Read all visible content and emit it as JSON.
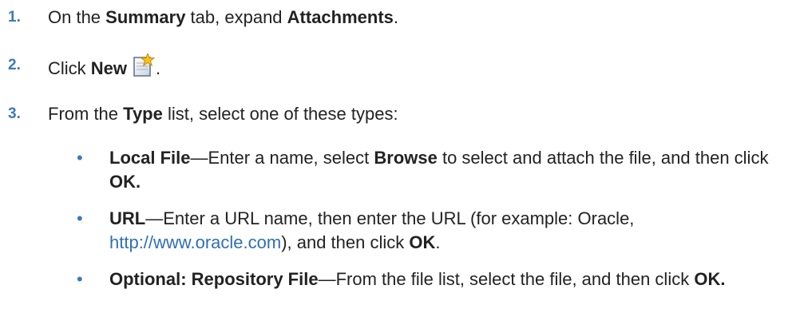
{
  "steps": [
    {
      "num": "1.",
      "pre": "On the ",
      "b1": "Summary",
      "mid": " tab, expand ",
      "b2": "Attachments",
      "post": "."
    },
    {
      "num": "2.",
      "pre": "Click ",
      "b1": "New",
      "icon": "new-document-icon",
      "post": "."
    },
    {
      "num": "3.",
      "pre": "From the ",
      "b1": "Type",
      "post": " list, select one of these types:"
    }
  ],
  "bullets": [
    {
      "mark": "•",
      "b1": "Local File",
      "t1": "—Enter a name, select ",
      "b2": "Browse",
      "t2": " to select and attach the file, and then click ",
      "b3": "OK."
    },
    {
      "mark": "•",
      "b1": "URL",
      "t1": "—Enter a URL name, then enter the URL (for example: Oracle, ",
      "link": "http://www.oracle.com",
      "t2": "), and then click ",
      "b2": "OK",
      "t3": "."
    },
    {
      "mark": "•",
      "b1": "Optional: Repository File",
      "t1": "—From the file list, select the file, and then click ",
      "b2": "OK."
    }
  ],
  "colors": {
    "number": "#3d7ab8",
    "link": "#2f6fb4",
    "text": "#222222"
  }
}
